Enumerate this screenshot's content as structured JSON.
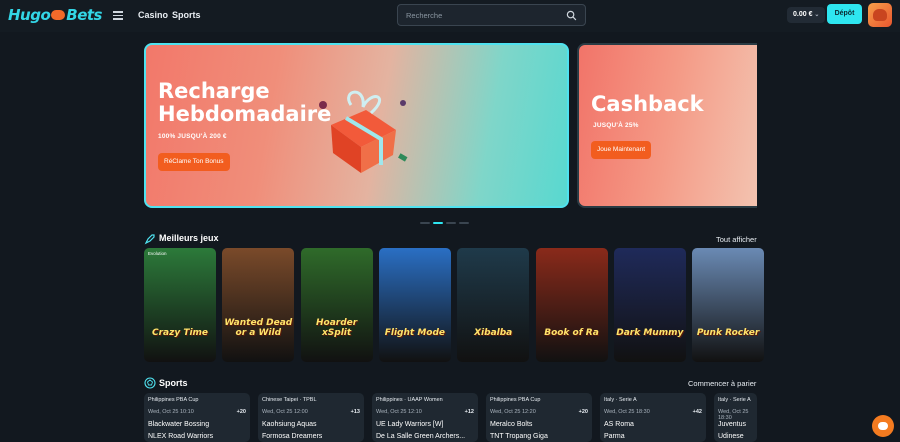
{
  "header": {
    "logo_left": "Hugo",
    "logo_right": "Bets",
    "nav": [
      "Casino",
      "Sports"
    ],
    "search_placeholder": "Recherche",
    "balance": "0.00 €",
    "deposit_label": "Dépôt"
  },
  "banners": [
    {
      "title_line1": "Recharge",
      "title_line2": "Hebdomadaire",
      "subtitle": "100% JUSQU'À 200 €",
      "button": "RéClame Ton Bonus"
    },
    {
      "title_line1": "Cashback",
      "subtitle": "JUSQU'À 25%",
      "button": "Joue Maintenant"
    }
  ],
  "games_section": {
    "title": "Meilleurs jeux",
    "link": "Tout afficher",
    "games": [
      {
        "name": "Crazy Time",
        "provider": "Evolution",
        "bg": "#2c7a3a"
      },
      {
        "name": "Wanted Dead or a Wild",
        "bg": "#7a4a2a"
      },
      {
        "name": "Hoarder xSplit",
        "bg": "#2f6b2a"
      },
      {
        "name": "Flight Mode",
        "bg": "#2a6fc4"
      },
      {
        "name": "Xibalba",
        "bg": "#1f3a4a"
      },
      {
        "name": "Book of Ra",
        "bg": "#8a2a1a"
      },
      {
        "name": "Dark Mummy",
        "bg": "#1f2a5a"
      },
      {
        "name": "Punk Rocker",
        "bg": "#6a8ab4"
      }
    ]
  },
  "sports_section": {
    "title": "Sports",
    "link": "Commencer à parier",
    "events": [
      {
        "league": "Philippines PBA Cup",
        "date": "Wed, Oct 25 10:10",
        "count": "+20",
        "team1": "Blackwater Bossing",
        "team2": "NLEX Road Warriors"
      },
      {
        "league": "Chinese Taipei · TPBL",
        "date": "Wed, Oct 25 12:00",
        "count": "+13",
        "team1": "Kaohsiung Aquas",
        "team2": "Formosa Dreamers"
      },
      {
        "league": "Philippines · UAAP Women",
        "date": "Wed, Oct 25 12:10",
        "count": "+12",
        "team1": "UE Lady Warriors [W]",
        "team2": "De La Salle Green Archers..."
      },
      {
        "league": "Philippines PBA Cup",
        "date": "Wed, Oct 25 12:20",
        "count": "+20",
        "team1": "Meralco Bolts",
        "team2": "TNT Tropang Giga"
      },
      {
        "league": "Italy · Serie A",
        "date": "Wed, Oct 25 18:30",
        "count": "+42",
        "team1": "AS Roma",
        "team2": "Parma"
      },
      {
        "league": "Italy · Serie A",
        "date": "Wed, Oct 25 18:30",
        "count": "",
        "team1": "Juventus",
        "team2": "Udinese"
      }
    ]
  }
}
